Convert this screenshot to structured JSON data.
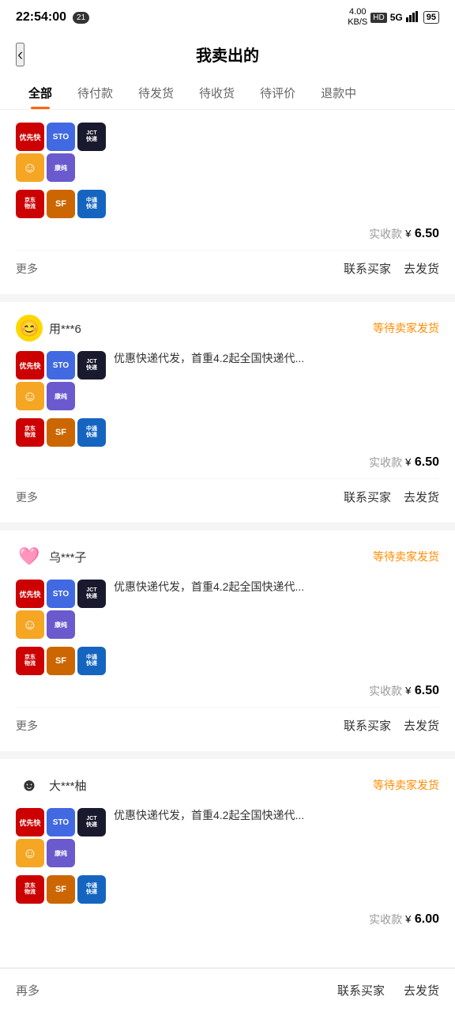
{
  "statusBar": {
    "time": "22:54:00",
    "badge": "21",
    "network": "4.00\nKB/S",
    "hd": "HD",
    "signal": "5G",
    "battery": "95"
  },
  "header": {
    "backLabel": "‹",
    "title": "我卖出的"
  },
  "tabs": [
    {
      "label": "全部",
      "active": true
    },
    {
      "label": "待付款",
      "active": false
    },
    {
      "label": "待发货",
      "active": false
    },
    {
      "label": "待收货",
      "active": false
    },
    {
      "label": "待评价",
      "active": false
    },
    {
      "label": "退款中",
      "active": false
    }
  ],
  "orders": [
    {
      "id": "order-1",
      "hasBuyer": false,
      "buyerName": "",
      "buyerAvatar": "",
      "status": "",
      "productTitle": "",
      "price": "6.50",
      "priceLabel": "实收款 ¥",
      "moreLabel": "更多",
      "btn1": "联系买家",
      "btn2": "去发货"
    },
    {
      "id": "order-2",
      "hasBuyer": true,
      "buyerName": "用***6",
      "buyerAvatar": "smiley",
      "status": "等待卖家发货",
      "productTitle": "优惠快递代发，首重4.2起全国快递代...",
      "price": "6.50",
      "priceLabel": "实收款 ¥",
      "moreLabel": "更多",
      "btn1": "联系买家",
      "btn2": "去发货"
    },
    {
      "id": "order-3",
      "hasBuyer": true,
      "buyerName": "乌***子",
      "buyerAvatar": "heart",
      "status": "等待卖家发货",
      "productTitle": "优惠快递代发，首重4.2起全国快递代...",
      "price": "6.50",
      "priceLabel": "实收款 ¥",
      "moreLabel": "更多",
      "btn1": "联系买家",
      "btn2": "去发货"
    },
    {
      "id": "order-4",
      "hasBuyer": true,
      "buyerName": "大***柚",
      "buyerAvatar": "smile",
      "status": "等待卖家发货",
      "productTitle": "优惠快递代发，首重4.2起全国快递代...",
      "price": "6.00",
      "priceLabel": "实收款 ¥",
      "moreLabel": "再多",
      "btn1": "联系买家",
      "btn2": "去发货"
    }
  ],
  "icons": [
    {
      "cls": "icon-ytk",
      "label": "优先快"
    },
    {
      "cls": "icon-sto",
      "label": "STO"
    },
    {
      "cls": "icon-jct",
      "label": "JCT快递"
    },
    {
      "cls": "icon-smile",
      "label": "☺"
    },
    {
      "cls": "icon-tnt",
      "label": "康纯"
    },
    {
      "cls": "icon-jdl",
      "label": "京东物流"
    },
    {
      "cls": "icon-sf",
      "label": "SF"
    },
    {
      "cls": "icon-zt",
      "label": "中通"
    }
  ]
}
